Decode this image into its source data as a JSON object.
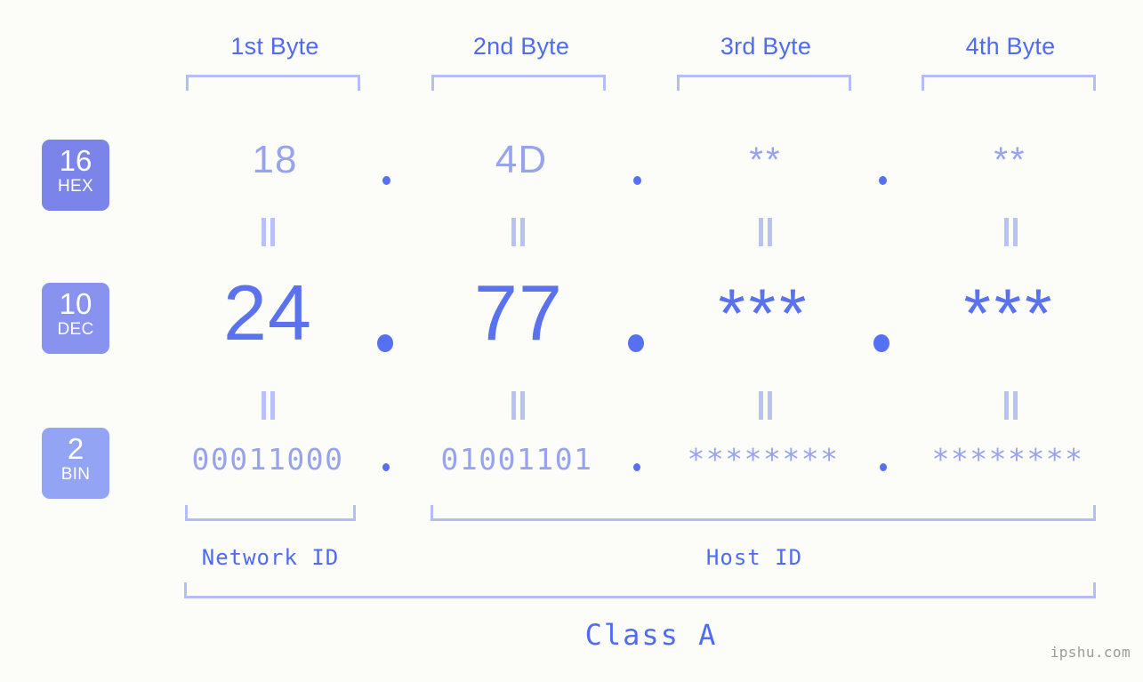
{
  "background_color": "#fcfdf8",
  "accent_colors": {
    "header_text": "#4f6bf0",
    "bracket": "#b4bdf5",
    "equals_marker": "#b9c2f7",
    "hex_value": "#98a3ee",
    "dec_value": "#5a72ee",
    "bin_value": "#98a3ee",
    "dot": "#5570f0",
    "badge_hex": "#7b84e9",
    "badge_dec": "#8893ef",
    "badge_bin": "#93a4f5"
  },
  "byte_headers": [
    {
      "label": "1st Byte"
    },
    {
      "label": "2nd Byte"
    },
    {
      "label": "3rd Byte"
    },
    {
      "label": "4th Byte"
    }
  ],
  "base_badges": [
    {
      "number": "16",
      "name": "HEX"
    },
    {
      "number": "10",
      "name": "DEC"
    },
    {
      "number": "2",
      "name": "BIN"
    }
  ],
  "rows": {
    "hex": {
      "base": "16",
      "base_name": "HEX",
      "values": [
        "18",
        "4D",
        "**",
        "**"
      ]
    },
    "dec": {
      "base": "10",
      "base_name": "DEC",
      "values": [
        "24",
        "77",
        "***",
        "***"
      ]
    },
    "bin": {
      "base": "2",
      "base_name": "BIN",
      "values": [
        "00011000",
        "01001101",
        "********",
        "********"
      ]
    }
  },
  "separator": ".",
  "equals_marker": "||",
  "section_labels": {
    "network_id": "Network ID",
    "host_id": "Host ID",
    "class": "Class A"
  },
  "watermark": "ipshu.com",
  "chart_data": {
    "type": "table",
    "title": "IPv4 address 24.77.*.* byte breakdown",
    "columns": [
      "1st Byte",
      "2nd Byte",
      "3rd Byte",
      "4th Byte"
    ],
    "rows": [
      {
        "base": 16,
        "base_label": "HEX",
        "values": [
          "18",
          "4D",
          "**",
          "**"
        ]
      },
      {
        "base": 10,
        "base_label": "DEC",
        "values": [
          "24",
          "77",
          "***",
          "***"
        ]
      },
      {
        "base": 2,
        "base_label": "BIN",
        "values": [
          "00011000",
          "01001101",
          "********",
          "********"
        ]
      }
    ],
    "groupings": [
      {
        "label": "Network ID",
        "bytes": [
          1
        ]
      },
      {
        "label": "Host ID",
        "bytes": [
          2,
          3,
          4
        ]
      },
      {
        "label": "Class A",
        "bytes": [
          1,
          2,
          3,
          4
        ]
      }
    ]
  }
}
